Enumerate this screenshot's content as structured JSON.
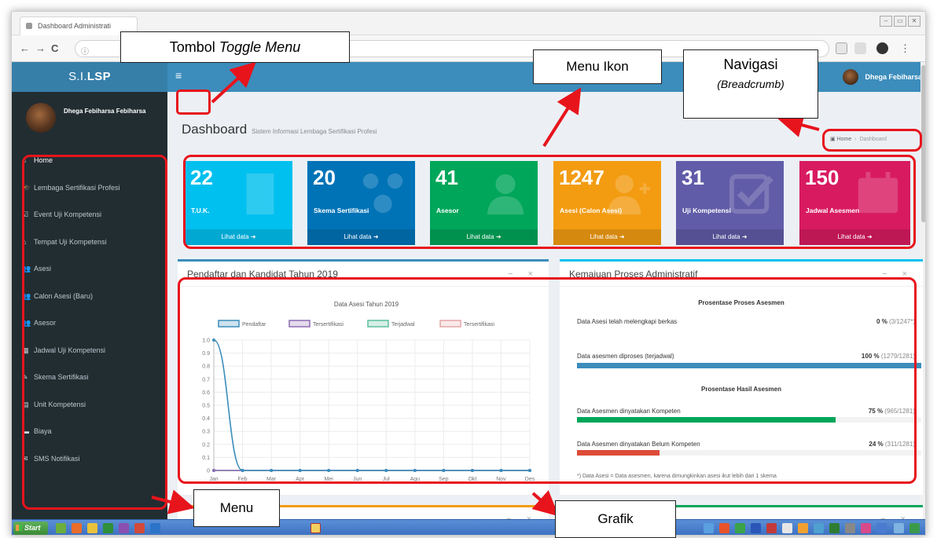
{
  "browser": {
    "tab_title": "Dashboard Administrati",
    "url_text": "Tombol Toggle Menu …… /home",
    "reload_glyph": "C",
    "back_glyph": "←",
    "forward_glyph": "→",
    "info_glyph": "ⓘ",
    "window_buttons": [
      "–",
      "▭",
      "✕"
    ]
  },
  "app": {
    "logo_prefix": "S.I.",
    "logo_bold": "LSP",
    "toggle_glyph": "≡",
    "user_name": "Dhega Febiharsa Febiharsa",
    "navbar_user": "Dhega Febiharsa"
  },
  "sidebar": {
    "items": [
      {
        "label": "Home",
        "icon": "home-icon",
        "glyph": "⌂"
      },
      {
        "label": "Lembaga Sertifikasi Profesi",
        "icon": "graduation-cap-icon",
        "glyph": "🎓"
      },
      {
        "label": "Event Uji Kompetensi",
        "icon": "checkbox-icon",
        "glyph": "☑"
      },
      {
        "label": "Tempat Uji Kompetensi",
        "icon": "institution-icon",
        "glyph": "⌂"
      },
      {
        "label": "Asesi",
        "icon": "users-icon",
        "glyph": "👥"
      },
      {
        "label": "Calon Asesi (Baru)",
        "icon": "users-icon",
        "glyph": "👥"
      },
      {
        "label": "Asesor",
        "icon": "users-icon",
        "glyph": "👥"
      },
      {
        "label": "Jadwal Uji Kompetensi",
        "icon": "calendar-icon",
        "glyph": "▦"
      },
      {
        "label": "Skema Sertifikasi",
        "icon": "edit-icon",
        "glyph": "✎"
      },
      {
        "label": "Unit Kompetensi",
        "icon": "file-icon",
        "glyph": "▤"
      },
      {
        "label": "Biaya",
        "icon": "money-icon",
        "glyph": "▬"
      },
      {
        "label": "SMS Notifikasi",
        "icon": "envelope-icon",
        "glyph": "✉"
      }
    ]
  },
  "page": {
    "title": "Dashboard",
    "subtitle": "Sistem Informasi Lembaga Sertifikasi Profesi",
    "breadcrumb_home": "Home",
    "breadcrumb_sep": "›",
    "breadcrumb_current": "Dashboard"
  },
  "stats": [
    {
      "value": "22",
      "label": "T.U.K.",
      "link": "Lihat data",
      "color": "#00c0ef",
      "icon": "building-icon"
    },
    {
      "value": "20",
      "label": "Skema Sertifikasi",
      "link": "Lihat data",
      "color": "#0073b7",
      "icon": "sitemap-icon"
    },
    {
      "value": "41",
      "label": "Asesor",
      "link": "Lihat data",
      "color": "#00a65a",
      "icon": "user-icon"
    },
    {
      "value": "1247",
      "label": "Asesi (Calon Asesi)",
      "link": "Lihat data",
      "color": "#f39c12",
      "icon": "user-plus-icon"
    },
    {
      "value": "31",
      "label": "Uji Kompetensi",
      "link": "Lihat data",
      "color": "#605ca8",
      "icon": "check-square-icon"
    },
    {
      "value": "150",
      "label": "Jadwal Asesmen",
      "link": "Lihat data",
      "color": "#d81b60",
      "icon": "calendar-icon"
    }
  ],
  "chart_panel": {
    "title": "Pendaftar dan Kandidat Tahun 2019",
    "tools": "− ×"
  },
  "chart_data": {
    "type": "line",
    "title": "Data Asesi Tahun 2019",
    "categories": [
      "Jan",
      "Feb",
      "Mar",
      "Apr",
      "Mei",
      "Jun",
      "Jul",
      "Agu",
      "Sep",
      "Okt",
      "Nov",
      "Des"
    ],
    "series": [
      {
        "name": "Pendaftar",
        "color": "#3c8dbc",
        "values": [
          1,
          0,
          0,
          0,
          0,
          0,
          0,
          0,
          0,
          0,
          0,
          0
        ]
      },
      {
        "name": "Tersertifikasi",
        "color": "#8e6bb3",
        "values": [
          0,
          0,
          0,
          0,
          0,
          0,
          0,
          0,
          0,
          0,
          0,
          0
        ]
      },
      {
        "name": "Terjadwal",
        "color": "#5bbf9b",
        "values": [
          0,
          0,
          0,
          0,
          0,
          0,
          0,
          0,
          0,
          0,
          0,
          0
        ]
      },
      {
        "name": "Tersertifikasi",
        "color": "#e6a6a6",
        "values": [
          0,
          0,
          0,
          0,
          0,
          0,
          0,
          0,
          0,
          0,
          0,
          0
        ]
      }
    ],
    "ylim": [
      0,
      1.0
    ],
    "yticks": [
      "0",
      "0.1",
      "0.2",
      "0.3",
      "0.4",
      "0.5",
      "0.6",
      "0.7",
      "0.8",
      "0.9",
      "1.0"
    ],
    "grid": true,
    "legend": "top"
  },
  "progress_panel": {
    "title": "Kemajuan Proses Administratif",
    "tools": "− ×",
    "section1": "Prosentase Proses Asesmen",
    "section2": "Prosentase Hasil Asesmen",
    "rows": [
      {
        "label": "Data Asesi telah melengkapi berkas",
        "pct": "0 %",
        "frac": "(3/1247*)",
        "fill": 0,
        "color": "#3c8dbc",
        "show_bar": false
      },
      {
        "label": "Data asesmen diproses (terjadwal)",
        "pct": "100 %",
        "frac": "(1279/1281)",
        "fill": 1.0,
        "color": "#3c8dbc",
        "show_bar": true
      },
      {
        "label": "Data Asesmen dinyatakan Kompeten",
        "pct": "75 %",
        "frac": "(965/1281)",
        "fill": 0.75,
        "color": "#00a65a",
        "show_bar": true
      },
      {
        "label": "Data Asesmen dinyatakan Belum Kompeten",
        "pct": "24 %",
        "frac": "(311/1281)",
        "fill": 0.24,
        "color": "#dd4b39",
        "show_bar": true
      }
    ],
    "footnote": "*) Data Asesi = Data asesmen, karena dimungkinkan asesi ikut lebih dari 1 skema"
  },
  "taskbar": {
    "start_label": "Start"
  },
  "annotations": {
    "toggle": {
      "pre": "Tombol ",
      "italic": "Toggle Menu"
    },
    "menu_icons": "Menu Ikon",
    "breadcrumb_line1": "Navigasi",
    "breadcrumb_line2": "(Breadcrumb)",
    "menu": "Menu",
    "chart": "Grafik"
  },
  "colors": {
    "annotation_red": "#e8141c",
    "header_blue": "#3c8dbc",
    "logo_blue": "#367fa9",
    "sidebar_dark": "#222d32"
  }
}
